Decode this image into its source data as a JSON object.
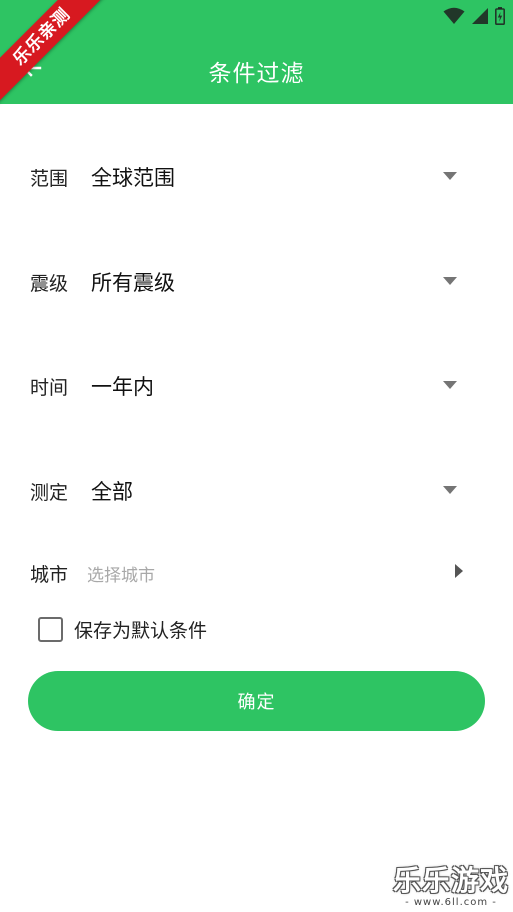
{
  "app_bar": {
    "title": "条件过滤"
  },
  "ribbon": {
    "text": "乐乐亲测"
  },
  "filters": [
    {
      "label": "范围",
      "value": "全球范围"
    },
    {
      "label": "震级",
      "value": "所有震级"
    },
    {
      "label": "时间",
      "value": "一年内"
    },
    {
      "label": "测定",
      "value": "全部"
    }
  ],
  "city": {
    "label": "城市",
    "placeholder": "选择城市"
  },
  "save_default": {
    "label": "保存为默认条件",
    "checked": false
  },
  "confirm_button": {
    "label": "确定"
  },
  "watermark": {
    "main": "乐乐游戏",
    "sub": "- www.6ll.com -"
  },
  "colors": {
    "primary": "#2ec463",
    "ribbon": "#d71920"
  }
}
